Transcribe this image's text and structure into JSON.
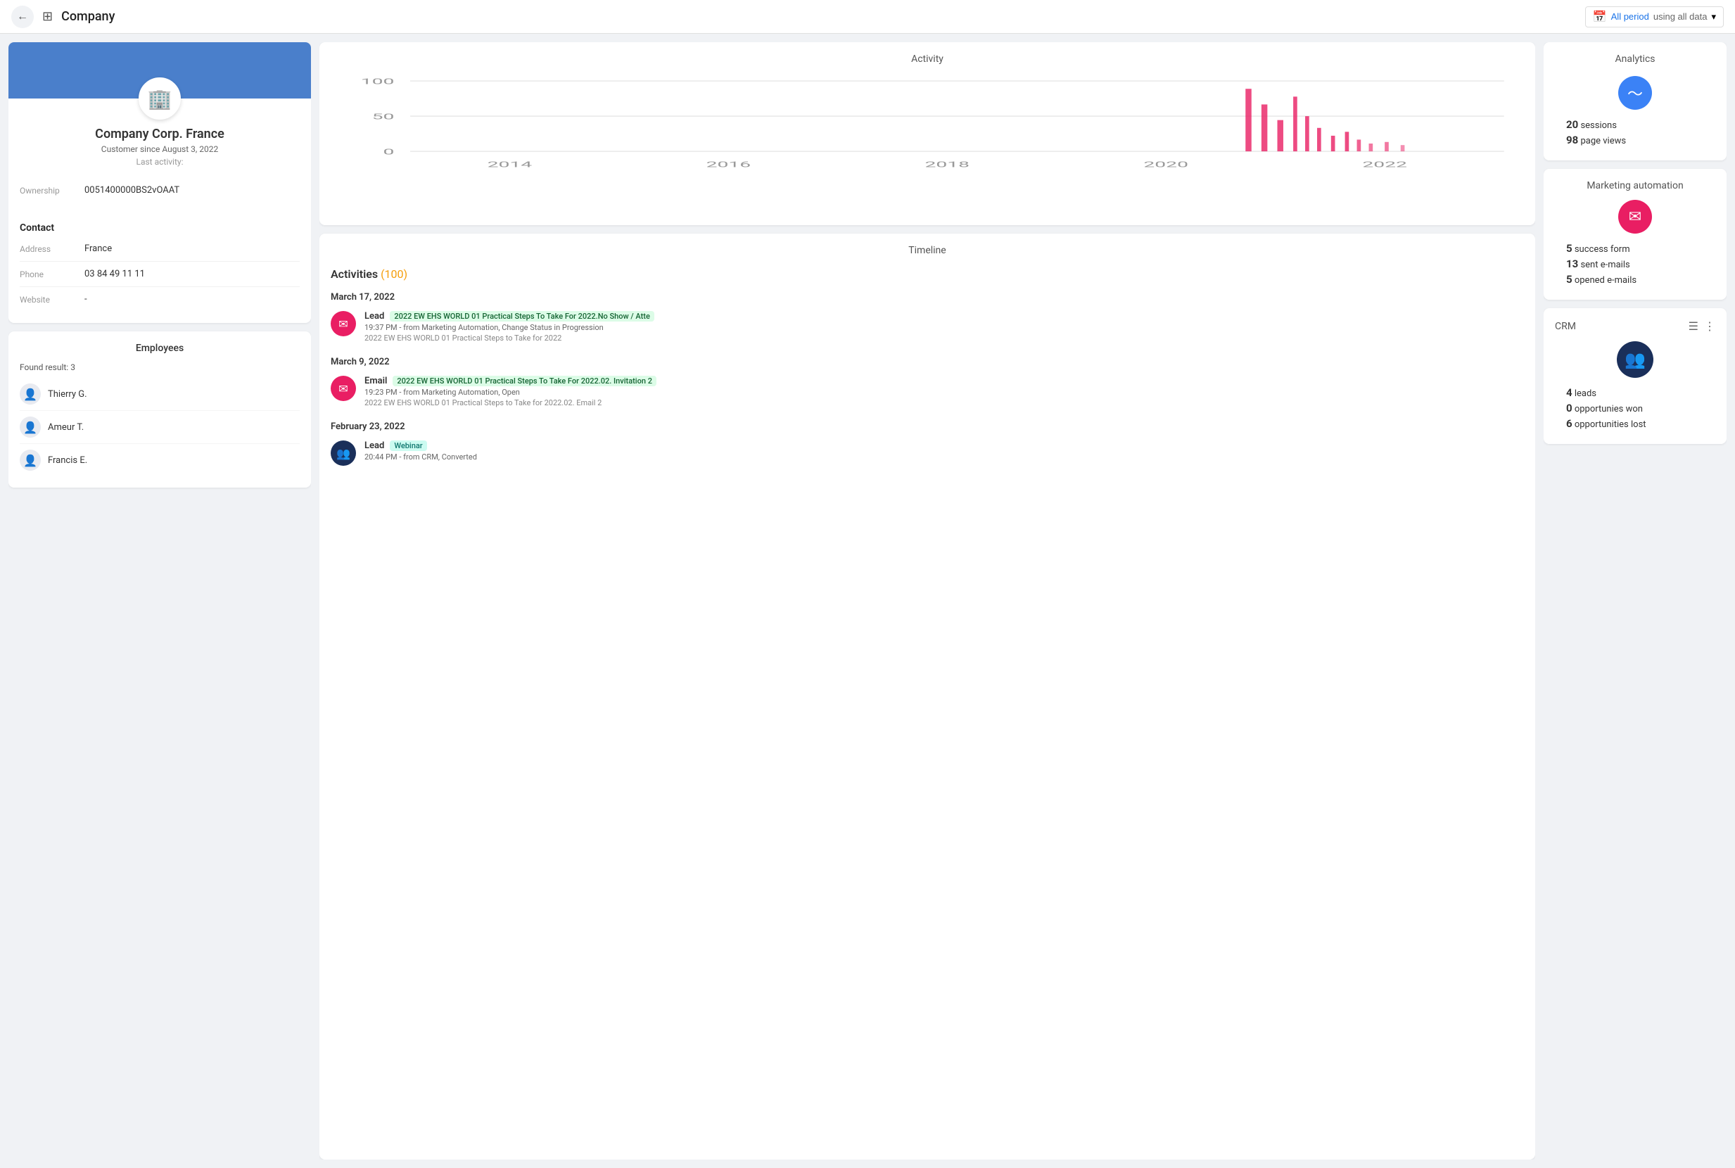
{
  "topNav": {
    "backLabel": "←",
    "gridIcon": "⊞",
    "title": "Company",
    "period": {
      "label": "All period",
      "sub": "using all data",
      "calIcon": "📅",
      "chevron": "▾"
    }
  },
  "profile": {
    "name": "Company Corp. France",
    "since": "Customer since August 3, 2022",
    "lastActivityLabel": "Last activity:",
    "ownership": {
      "label": "Ownership",
      "value": "0051400000BS2vOAAT"
    },
    "contactSection": "Contact",
    "address": {
      "label": "Address",
      "value": "France"
    },
    "phone": {
      "label": "Phone",
      "value": "03 84 49 11 11"
    },
    "website": {
      "label": "Website",
      "value": "-"
    }
  },
  "employees": {
    "title": "Employees",
    "foundResult": "Found result: 3",
    "list": [
      {
        "name": "Thierry G."
      },
      {
        "name": "Ameur T."
      },
      {
        "name": "Francis E."
      }
    ]
  },
  "activity": {
    "title": "Activity",
    "yLabels": [
      "100",
      "50",
      "0"
    ],
    "xLabels": [
      "2014",
      "2016",
      "2018",
      "2020",
      "2022"
    ]
  },
  "timeline": {
    "title": "Timeline",
    "activitiesLabel": "Activities",
    "activitiesCount": "(100)",
    "groups": [
      {
        "date": "March 17, 2022",
        "items": [
          {
            "type": "Lead",
            "badgeText": "2022 EW EHS WORLD 01 Practical Steps To Take For 2022.No Show / Atte",
            "badgeClass": "green",
            "meta": "19:37 PM - from Marketing Automation, Change Status in Progression",
            "sub": "2022 EW EHS WORLD 01 Practical Steps to Take for 2022",
            "iconType": "email",
            "iconClass": ""
          }
        ]
      },
      {
        "date": "March 9, 2022",
        "items": [
          {
            "type": "Email",
            "badgeText": "2022 EW EHS WORLD 01 Practical Steps To Take For 2022.02. Invitation 2",
            "badgeClass": "green",
            "meta": "19:23 PM - from Marketing Automation, Open",
            "sub": "2022 EW EHS WORLD 01 Practical Steps to Take for 2022.02. Email 2",
            "iconType": "email",
            "iconClass": ""
          }
        ]
      },
      {
        "date": "February 23, 2022",
        "items": [
          {
            "type": "Lead",
            "badgeText": "Webinar",
            "badgeClass": "teal",
            "meta": "20:44 PM - from CRM, Converted",
            "sub": "",
            "iconType": "crm",
            "iconClass": "dark"
          }
        ]
      }
    ]
  },
  "analytics": {
    "title": "Analytics",
    "sessions": "20",
    "sessionsLabel": "sessions",
    "pageViews": "98",
    "pageViewsLabel": "page views"
  },
  "marketingAutomation": {
    "title": "Marketing automation",
    "successForm": "5",
    "successFormLabel": "success form",
    "sentEmails": "13",
    "sentEmailsLabel": "sent e-mails",
    "openedEmails": "5",
    "openedEmailsLabel": "opened e-mails"
  },
  "crm": {
    "title": "CRM",
    "leads": "4",
    "leadsLabel": "leads",
    "opportunitiesWon": "0",
    "opportunitiesWonLabel": "opportunies won",
    "opportunitiesLost": "6",
    "opportunitiesLostLabel": "opportunities lost"
  }
}
